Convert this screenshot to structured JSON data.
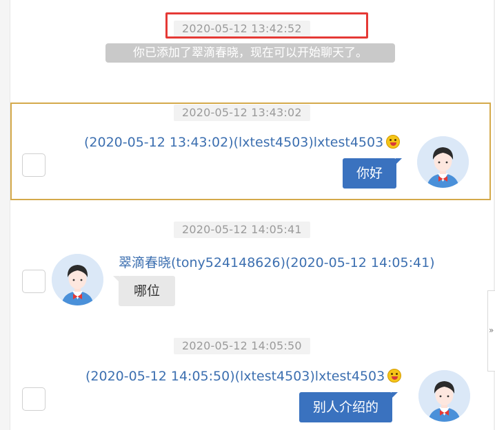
{
  "system_block": {
    "timestamp": "2020-05-12 13:42:52",
    "notice": "你已添加了翠滴春晓，现在可以开始聊天了。"
  },
  "messages": [
    {
      "timestamp": "2020-05-12 13:43:02",
      "sender": "(2020-05-12 13:43:02)(lxtest4503)lxtest4503",
      "text": "你好",
      "direction": "outgoing",
      "selected": true
    },
    {
      "timestamp": "2020-05-12 14:05:41",
      "sender": "翠滴春晓(tony524148626)(2020-05-12 14:05:41)",
      "text": "哪位",
      "direction": "incoming",
      "selected": false
    },
    {
      "timestamp": "2020-05-12 14:05:50",
      "sender": "(2020-05-12 14:05:50)(lxtest4503)lxtest4503",
      "text": "别人介绍的",
      "direction": "outgoing",
      "selected": false
    }
  ],
  "side_tab": {
    "glyph": "»"
  },
  "colors": {
    "outgoing_bubble": "#3a72bf",
    "incoming_bubble": "#e8e8e8",
    "sender_name": "#3c6fb0",
    "selection_border": "#d4a94a",
    "highlight_box": "#e53935",
    "avatar_background": "#dbe8f7"
  },
  "icons": {
    "avatar": "user-avatar-icon",
    "emoji": "grinning-face-emoji-icon",
    "checkbox": "checkbox-icon"
  }
}
